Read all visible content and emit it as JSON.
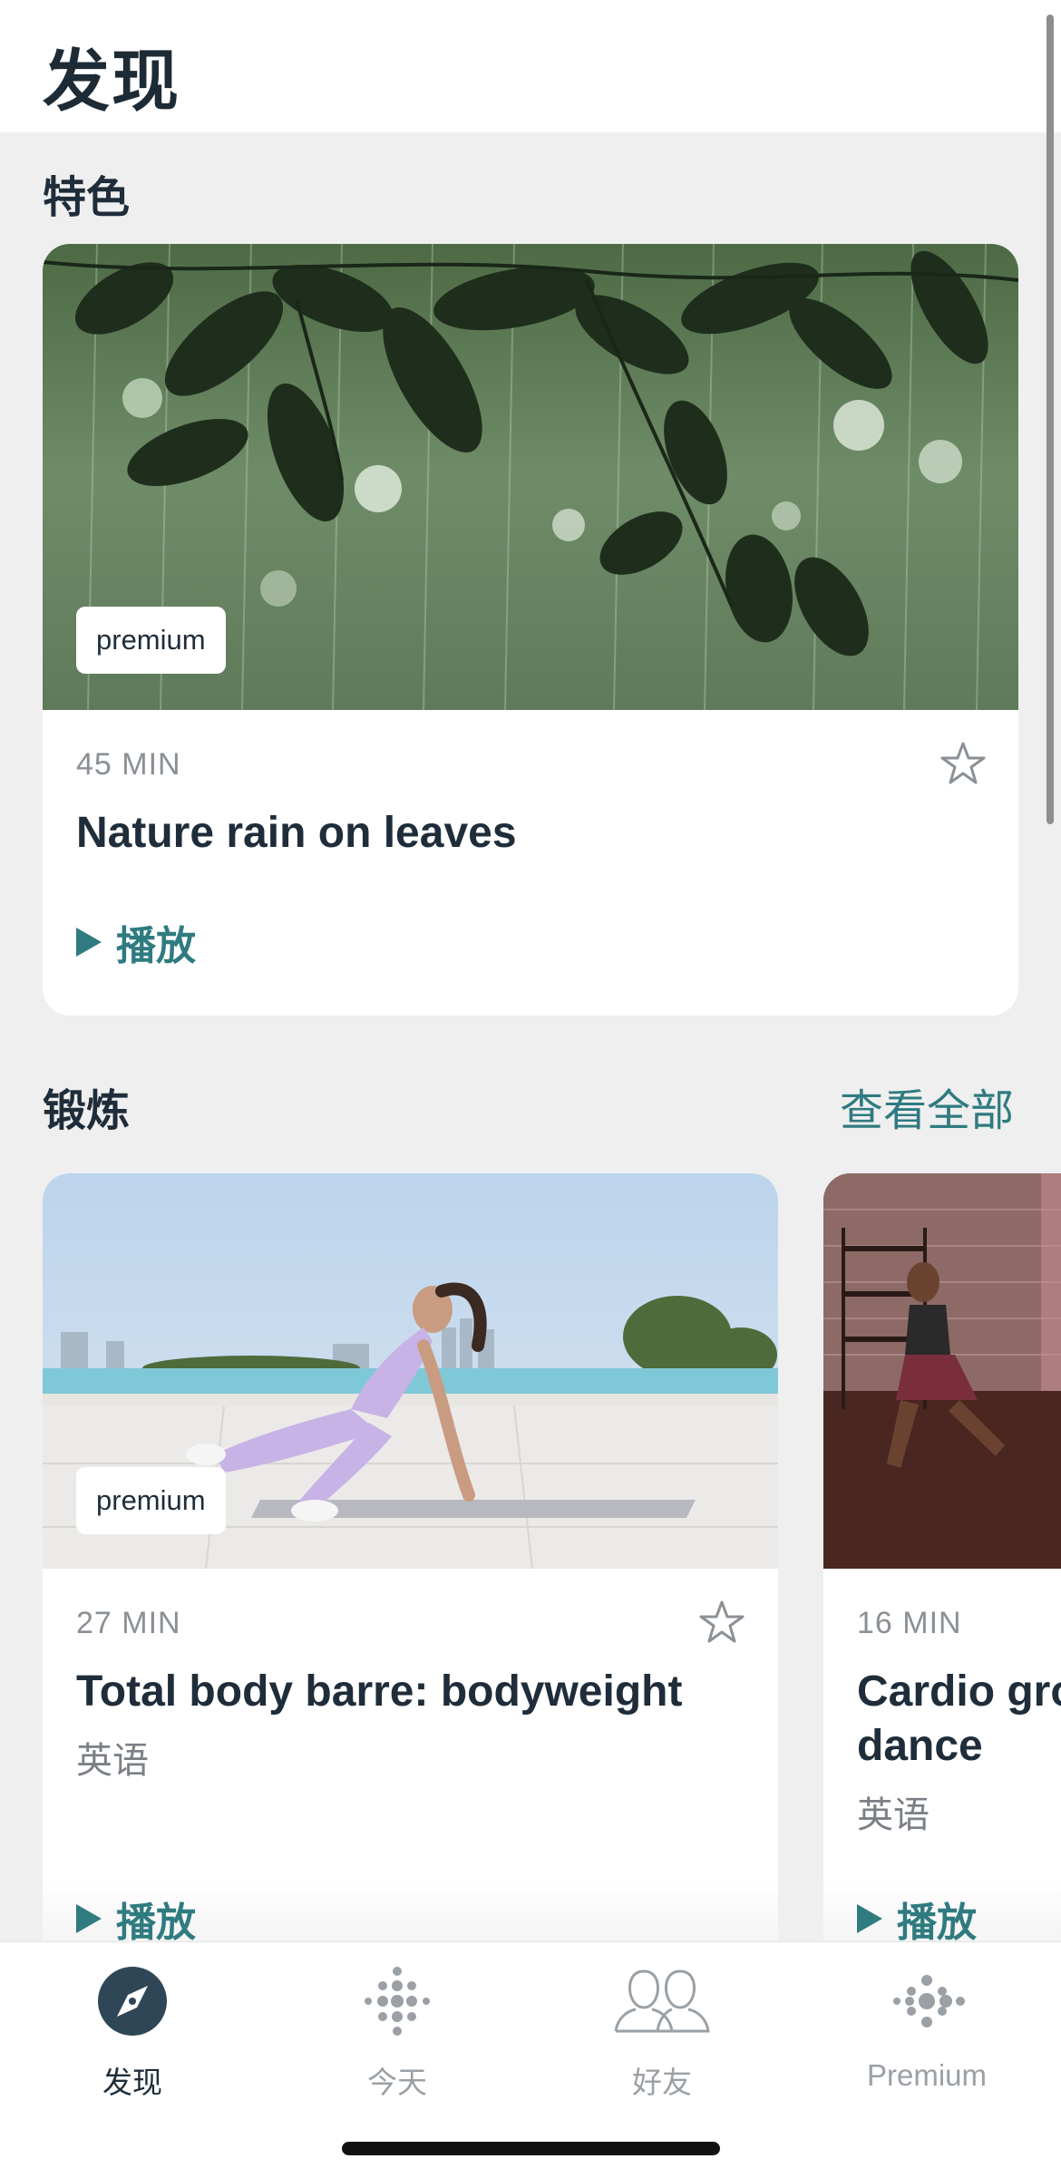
{
  "header": {
    "title": "发现"
  },
  "featured": {
    "section_title": "特色",
    "card": {
      "badge": "premium",
      "duration": "45 MIN",
      "title": "Nature rain on leaves",
      "play_label": "播放"
    }
  },
  "workouts": {
    "section_title": "锻炼",
    "see_all_label": "查看全部",
    "cards": [
      {
        "badge": "premium",
        "duration": "27 MIN",
        "title": "Total body barre: bodyweight",
        "language": "英语",
        "play_label": "播放"
      },
      {
        "duration": "16 MIN",
        "title_line1": "Cardio gro",
        "title_line2": "dance",
        "language": "英语",
        "play_label": "播放"
      }
    ]
  },
  "tabbar": {
    "tabs": [
      {
        "label": "发现",
        "icon": "compass-icon",
        "active": true
      },
      {
        "label": "今天",
        "icon": "fitbit-dots-icon",
        "active": false
      },
      {
        "label": "好友",
        "icon": "friends-icon",
        "active": false
      },
      {
        "label": "Premium",
        "icon": "premium-dots-icon",
        "active": false
      }
    ]
  },
  "colors": {
    "accent": "#2f7b80",
    "text": "#1f2d3a",
    "muted": "#8a9095",
    "background": "#efefef"
  }
}
